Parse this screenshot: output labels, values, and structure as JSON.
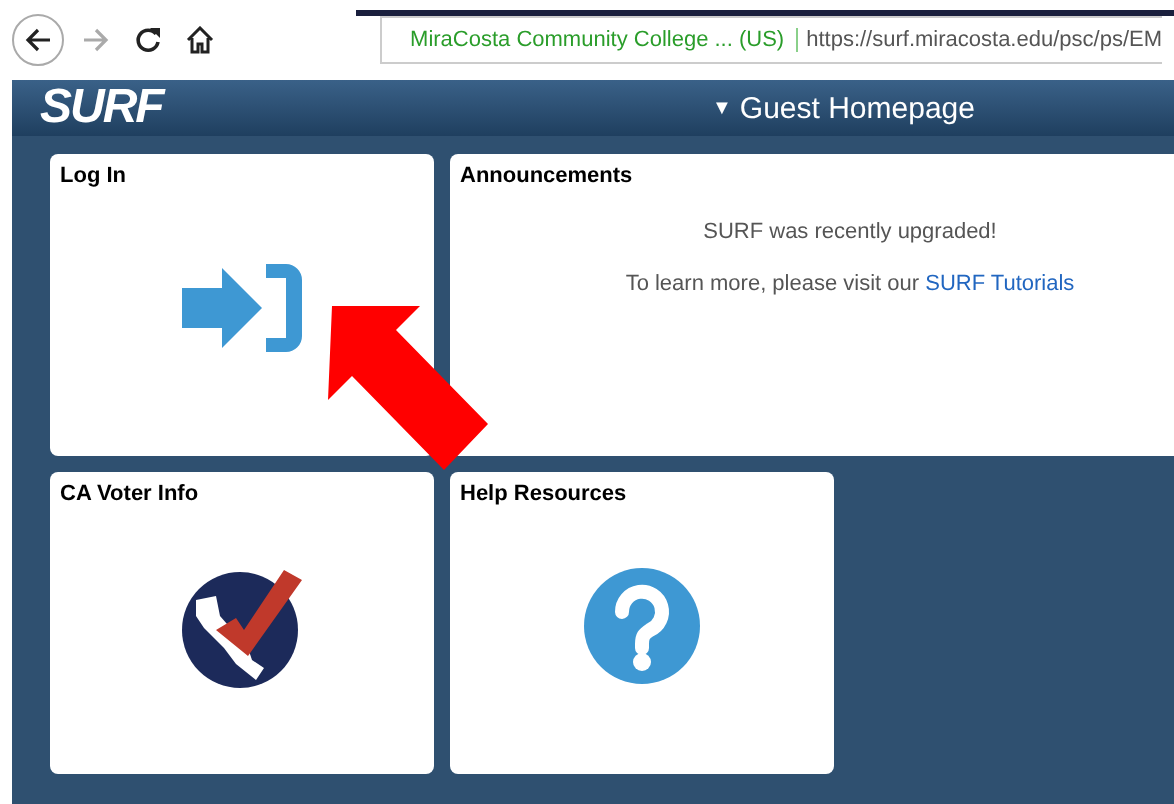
{
  "browser": {
    "site_identity": "MiraCosta Community College ... (US)",
    "url": "https://surf.miracosta.edu/psc/ps/EM"
  },
  "header": {
    "logo": "SURF",
    "title": "Guest Homepage",
    "caret": "▼"
  },
  "tiles": [
    {
      "title": "Log In",
      "kind": "login"
    },
    {
      "title": "Announcements",
      "kind": "text",
      "lines": [
        "SURF was recently upgraded!"
      ],
      "link_prefix": "To learn more, please visit our ",
      "link": "SURF Tutorials"
    },
    {
      "title": "CA Voter Info",
      "kind": "voter"
    },
    {
      "title": "Help Resources",
      "kind": "help"
    }
  ]
}
